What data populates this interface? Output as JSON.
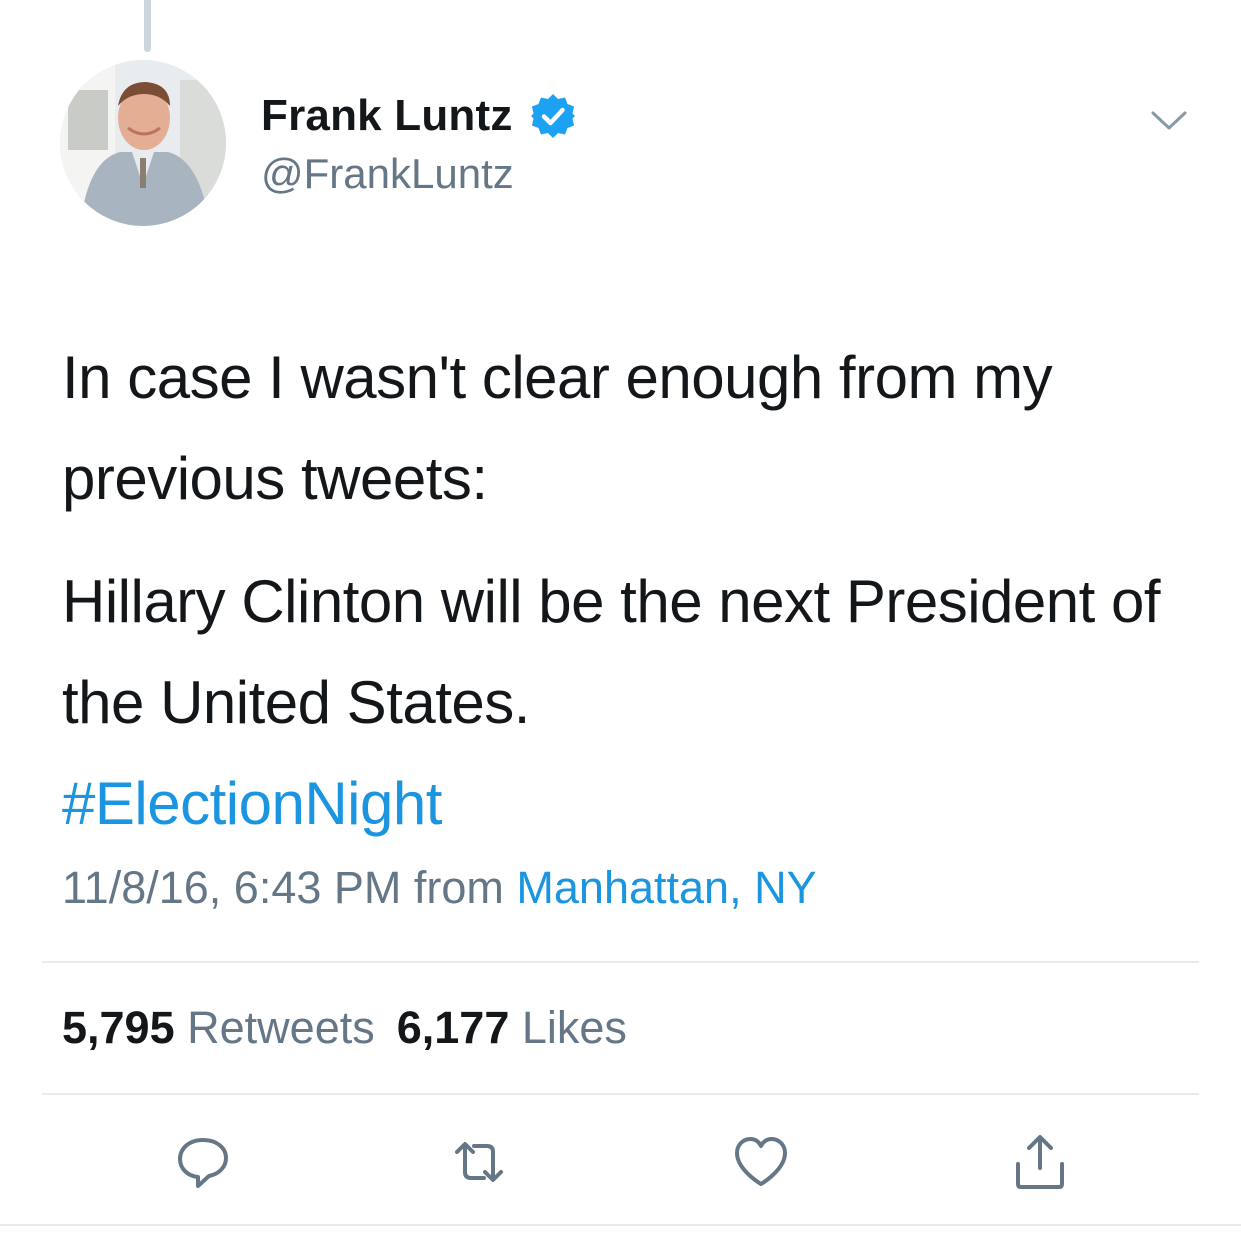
{
  "tweet": {
    "author": {
      "display_name": "Frank Luntz",
      "handle": "@FrankLuntz",
      "verified": true
    },
    "text_paragraphs": [
      "In case I wasn't clear enough from my previous tweets:",
      "Hillary Clinton will be the next President of the United States."
    ],
    "hashtag": "#ElectionNight",
    "timestamp": "11/8/16, 6:43 PM",
    "from_label": "from",
    "location": "Manhattan, NY",
    "stats": {
      "retweets_count": "5,795",
      "retweets_label": "Retweets",
      "likes_count": "6,177",
      "likes_label": "Likes"
    },
    "actions": [
      "reply-icon",
      "retweet-icon",
      "like-icon",
      "share-icon"
    ]
  },
  "colors": {
    "link": "#1b95e0",
    "secondary_text": "#657786",
    "primary_text": "#14171a",
    "divider": "#e6ecf0"
  }
}
